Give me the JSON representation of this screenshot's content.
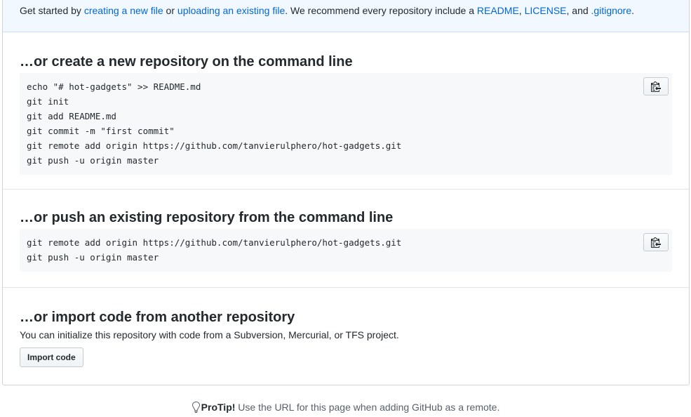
{
  "getstarted": {
    "prefix": "Get started by ",
    "create_link": "creating a new file",
    "or_text": " or ",
    "upload_link": "uploading an existing file",
    "recommend_text": ". We recommend every repository include a ",
    "readme_link": "README",
    "comma": ", ",
    "license_link": "LICENSE",
    "and_text": ", and ",
    "gitignore_link": ".gitignore",
    "period": "."
  },
  "create_section": {
    "title": "…or create a new repository on the command line",
    "code": "echo \"# hot-gadgets\" >> README.md\ngit init\ngit add README.md\ngit commit -m \"first commit\"\ngit remote add origin https://github.com/tanvierulphero/hot-gadgets.git\ngit push -u origin master"
  },
  "push_section": {
    "title": "…or push an existing repository from the command line",
    "code": "git remote add origin https://github.com/tanvierulphero/hot-gadgets.git\ngit push -u origin master"
  },
  "import_section": {
    "title": "…or import code from another repository",
    "description": "You can initialize this repository with code from a Subversion, Mercurial, or TFS project.",
    "button_label": "Import code"
  },
  "protip": {
    "label": "ProTip!",
    "text": " Use the URL for this page when adding GitHub as a remote."
  },
  "icons": {
    "copy": "clippy-icon",
    "tip": "light-bulb-icon"
  },
  "colors": {
    "link": "#0366d6",
    "banner_bg": "#f1f8ff",
    "code_bg": "#f6f8fa"
  }
}
